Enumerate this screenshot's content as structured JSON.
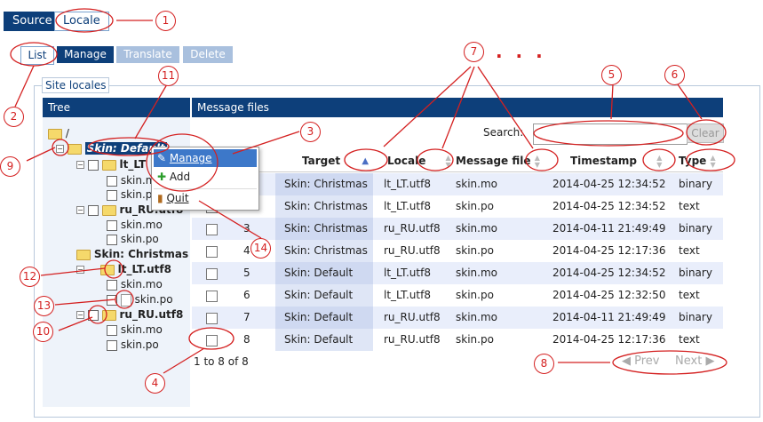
{
  "top_buttons": {
    "source": "Source",
    "locale": "Locale"
  },
  "sub_tabs": {
    "list": "List",
    "manage": "Manage",
    "translate": "Translate",
    "delete": "Delete"
  },
  "section_title": "Site locales",
  "tree_header": "Tree",
  "files_header": "Message files",
  "tree": {
    "root": "/",
    "skin_default": "Skin: Default",
    "lt_lt": "lt_LT",
    "ru_ru": "ru_RU.utf8",
    "skin_mo": "skin.mo",
    "skin_po": "skin.po",
    "skin_christmas": "Skin: Christmas",
    "lt_lt_utf8": "lt_LT.utf8",
    "ru_ru_utf8": "ru_RU.utf8"
  },
  "context_menu": {
    "manage": "Manage",
    "add": "Add",
    "quit": "Quit"
  },
  "search": {
    "label": "Search:",
    "placeholder": "",
    "clear": "Clear"
  },
  "columns": {
    "target": "Target",
    "locale": "Locale",
    "message_file": "Message file",
    "timestamp": "Timestamp",
    "type": "Type"
  },
  "rows": [
    {
      "num": "1",
      "target": "Skin: Christmas",
      "locale": "lt_LT.utf8",
      "file": "skin.mo",
      "timestamp": "2014-04-25 12:34:52",
      "type": "binary"
    },
    {
      "num": "2",
      "target": "Skin: Christmas",
      "locale": "lt_LT.utf8",
      "file": "skin.po",
      "timestamp": "2014-04-25 12:34:52",
      "type": "text"
    },
    {
      "num": "3",
      "target": "Skin: Christmas",
      "locale": "ru_RU.utf8",
      "file": "skin.mo",
      "timestamp": "2014-04-11 21:49:49",
      "type": "binary"
    },
    {
      "num": "4",
      "target": "Skin: Christmas",
      "locale": "ru_RU.utf8",
      "file": "skin.po",
      "timestamp": "2014-04-25 12:17:36",
      "type": "text"
    },
    {
      "num": "5",
      "target": "Skin: Default",
      "locale": "lt_LT.utf8",
      "file": "skin.mo",
      "timestamp": "2014-04-25 12:34:52",
      "type": "binary"
    },
    {
      "num": "6",
      "target": "Skin: Default",
      "locale": "lt_LT.utf8",
      "file": "skin.po",
      "timestamp": "2014-04-25 12:32:50",
      "type": "text"
    },
    {
      "num": "7",
      "target": "Skin: Default",
      "locale": "ru_RU.utf8",
      "file": "skin.mo",
      "timestamp": "2014-04-11 21:49:49",
      "type": "binary"
    },
    {
      "num": "8",
      "target": "Skin: Default",
      "locale": "ru_RU.utf8",
      "file": "skin.po",
      "timestamp": "2014-04-25 12:17:36",
      "type": "text"
    }
  ],
  "pagination": {
    "summary": "1 to 8 of 8",
    "prev": "Prev",
    "next": "Next"
  },
  "annotations": {
    "a1": "1",
    "a2": "2",
    "a3": "3",
    "a4": "4",
    "a5": "5",
    "a6": "6",
    "a7": "7",
    "a8": "8",
    "a9": "9",
    "a10": "10",
    "a11": "11",
    "a12": "12",
    "a13": "13",
    "a14": "14",
    "dots": ". . ."
  },
  "colors": {
    "accent": "#0d3f7a",
    "annotation": "#d42020"
  }
}
